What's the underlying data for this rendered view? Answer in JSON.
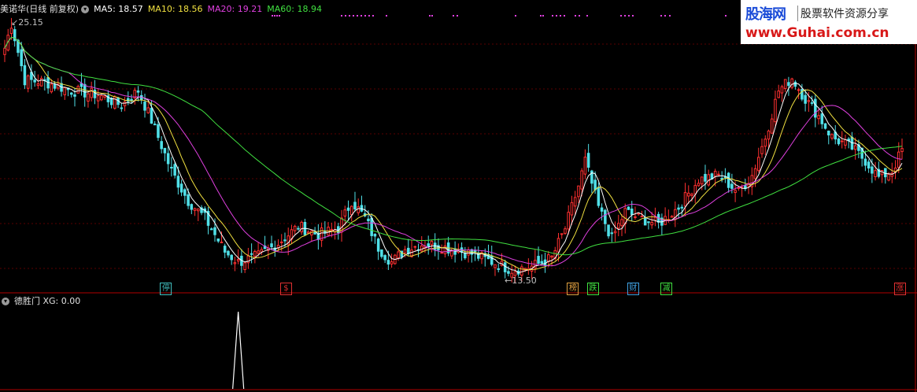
{
  "header": {
    "stock_title": "美诺华(日线 前复权)",
    "ma_labels": [
      {
        "text": "MA5: 18.57",
        "color": "#ffffff"
      },
      {
        "text": "MA10: 18.56",
        "color": "#f0e040"
      },
      {
        "text": "MA20: 19.21",
        "color": "#e040e0"
      },
      {
        "text": "MA60: 18.94",
        "color": "#40e040"
      }
    ]
  },
  "sub_header": {
    "indicator_title": "德胜门 XG: 0.00"
  },
  "watermark": {
    "brand": "股海网",
    "slogan": "股票软件资源分享",
    "url": "www.Guhai.com.cn"
  },
  "price_labels": {
    "high": "25.15",
    "low": "13.50"
  },
  "signals": [
    {
      "text": "停",
      "color": "#40c0c0",
      "idx": 48
    },
    {
      "text": "$",
      "color": "#e03030",
      "idx": 84
    },
    {
      "text": "榜",
      "color": "#e0a040",
      "idx": 170
    },
    {
      "text": "跌",
      "color": "#40e040",
      "idx": 176
    },
    {
      "text": "财",
      "color": "#40a0e0",
      "idx": 188
    },
    {
      "text": "减",
      "color": "#40e040",
      "idx": 198
    },
    {
      "text": "涨",
      "color": "#e03030",
      "idx": 268
    }
  ],
  "chart_data": {
    "type": "candlestick",
    "series_names": [
      "MA5",
      "MA10",
      "MA20",
      "MA60"
    ],
    "series_colors": {
      "up": "#ff3030",
      "down": "#50e0e8",
      "MA5": "#ffffff",
      "MA10": "#f0e040",
      "MA20": "#e040e0",
      "MA60": "#40e040"
    },
    "ylim": [
      13.2,
      25.6
    ],
    "bar_count": 270,
    "key_points": [
      [
        0,
        24.0
      ],
      [
        2,
        25.15
      ],
      [
        6,
        22.5
      ],
      [
        12,
        22.4
      ],
      [
        20,
        22.0
      ],
      [
        28,
        21.8
      ],
      [
        35,
        21.3
      ],
      [
        40,
        22.0
      ],
      [
        44,
        20.6
      ],
      [
        50,
        18.2
      ],
      [
        55,
        16.8
      ],
      [
        60,
        16.0
      ],
      [
        66,
        14.4
      ],
      [
        70,
        13.9
      ],
      [
        76,
        14.2
      ],
      [
        82,
        14.8
      ],
      [
        88,
        15.6
      ],
      [
        94,
        15.2
      ],
      [
        100,
        15.5
      ],
      [
        104,
        16.8
      ],
      [
        108,
        16.0
      ],
      [
        112,
        14.6
      ],
      [
        116,
        13.9
      ],
      [
        120,
        14.5
      ],
      [
        126,
        14.8
      ],
      [
        132,
        14.6
      ],
      [
        140,
        14.3
      ],
      [
        148,
        13.8
      ],
      [
        152,
        13.55
      ],
      [
        158,
        13.7
      ],
      [
        164,
        14.1
      ],
      [
        168,
        15.5
      ],
      [
        172,
        17.5
      ],
      [
        174,
        18.7
      ],
      [
        178,
        16.5
      ],
      [
        182,
        15.0
      ],
      [
        186,
        16.3
      ],
      [
        190,
        16.0
      ],
      [
        196,
        15.7
      ],
      [
        202,
        16.5
      ],
      [
        208,
        17.8
      ],
      [
        214,
        18.0
      ],
      [
        220,
        17.2
      ],
      [
        224,
        18.0
      ],
      [
        228,
        19.8
      ],
      [
        232,
        22.0
      ],
      [
        236,
        22.6
      ],
      [
        240,
        21.6
      ],
      [
        244,
        20.8
      ],
      [
        248,
        19.8
      ],
      [
        254,
        19.3
      ],
      [
        258,
        18.7
      ],
      [
        262,
        17.9
      ],
      [
        266,
        18.2
      ],
      [
        269,
        19.2
      ]
    ],
    "indicator": {
      "name": "XG",
      "ylim": [
        0,
        1
      ],
      "spikes": [
        70
      ]
    }
  }
}
